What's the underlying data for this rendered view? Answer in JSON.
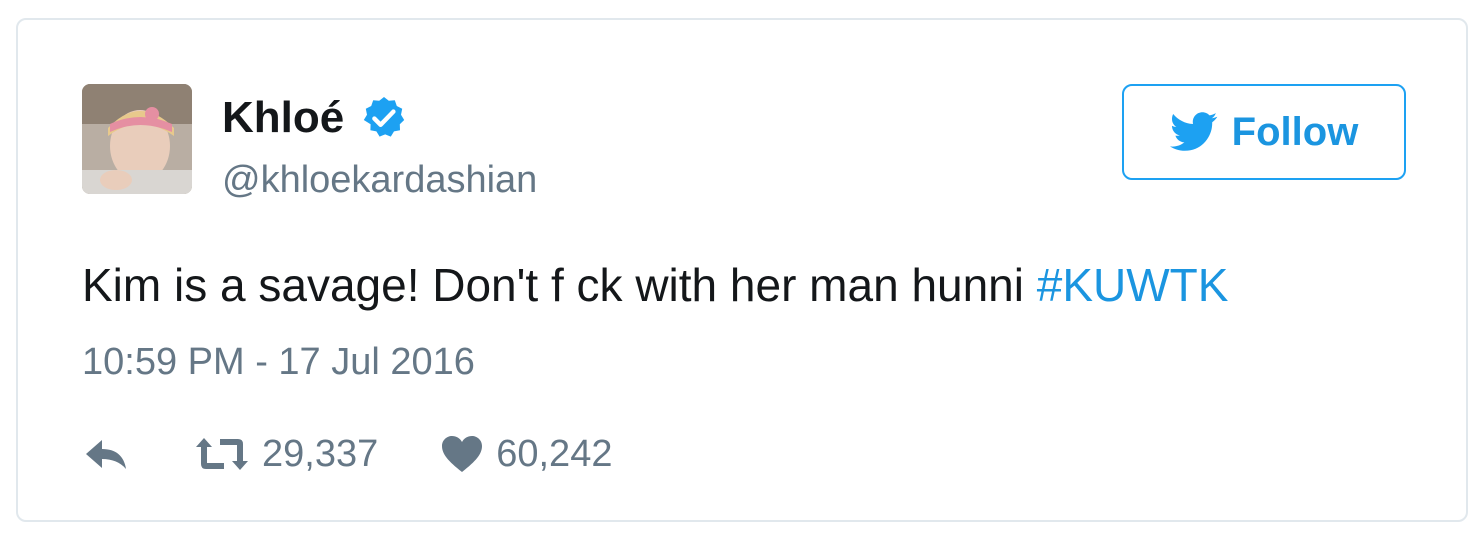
{
  "author": {
    "name": "Khloé",
    "handle": "@khloekardashian"
  },
  "follow_button": {
    "label": "Follow"
  },
  "tweet": {
    "text": "Kim is a savage! Don't f  ck with her man hunni ",
    "hashtag": "#KUWTK",
    "timestamp": "10:59 PM - 17 Jul 2016"
  },
  "actions": {
    "retweets": "29,337",
    "likes": "60,242"
  },
  "icons": [
    "verified-badge-icon",
    "twitter-bird-icon",
    "reply-icon",
    "retweet-icon",
    "heart-icon"
  ],
  "colors": {
    "accent": "#1b95e0",
    "verified": "#1da1f2",
    "text": "#14171a",
    "muted": "#657786",
    "border": "#e1e8ed"
  }
}
